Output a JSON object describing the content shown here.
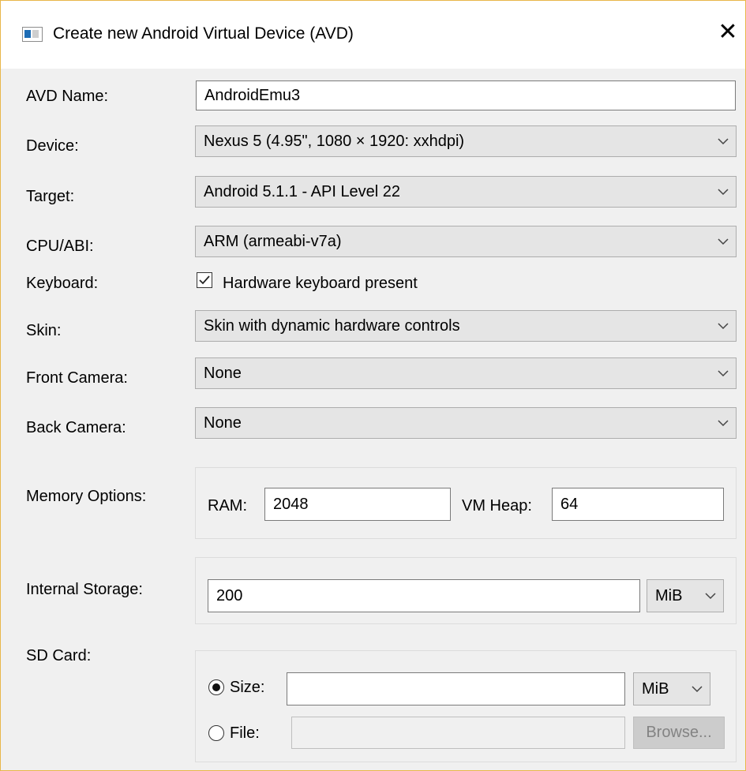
{
  "window": {
    "title": "Create new Android Virtual Device (AVD)",
    "close_glyph": "✕"
  },
  "labels": {
    "avd_name": "AVD Name:",
    "device": "Device:",
    "target": "Target:",
    "cpu_abi": "CPU/ABI:",
    "keyboard": "Keyboard:",
    "skin": "Skin:",
    "front_camera": "Front Camera:",
    "back_camera": "Back Camera:",
    "memory_options": "Memory Options:",
    "internal_storage": "Internal Storage:",
    "sd_card": "SD Card:"
  },
  "fields": {
    "avd_name": "AndroidEmu3",
    "device": "Nexus 5 (4.95\", 1080 × 1920: xxhdpi)",
    "target": "Android 5.1.1 - API Level 22",
    "cpu_abi": "ARM (armeabi-v7a)",
    "keyboard_checkbox_label": "Hardware keyboard present",
    "keyboard_checked": true,
    "skin": "Skin with dynamic hardware controls",
    "front_camera": "None",
    "back_camera": "None"
  },
  "memory": {
    "ram_label": "RAM:",
    "ram_value": "2048",
    "vm_heap_label": "VM Heap:",
    "vm_heap_value": "64"
  },
  "internal_storage": {
    "value": "200",
    "unit": "MiB"
  },
  "sd_card": {
    "size_label": "Size:",
    "size_value": "",
    "size_unit": "MiB",
    "size_selected": true,
    "file_label": "File:",
    "file_value": "",
    "browse_label": "Browse..."
  },
  "icons": {
    "app": "window-icon",
    "dropdown": "chevron-down-icon"
  }
}
